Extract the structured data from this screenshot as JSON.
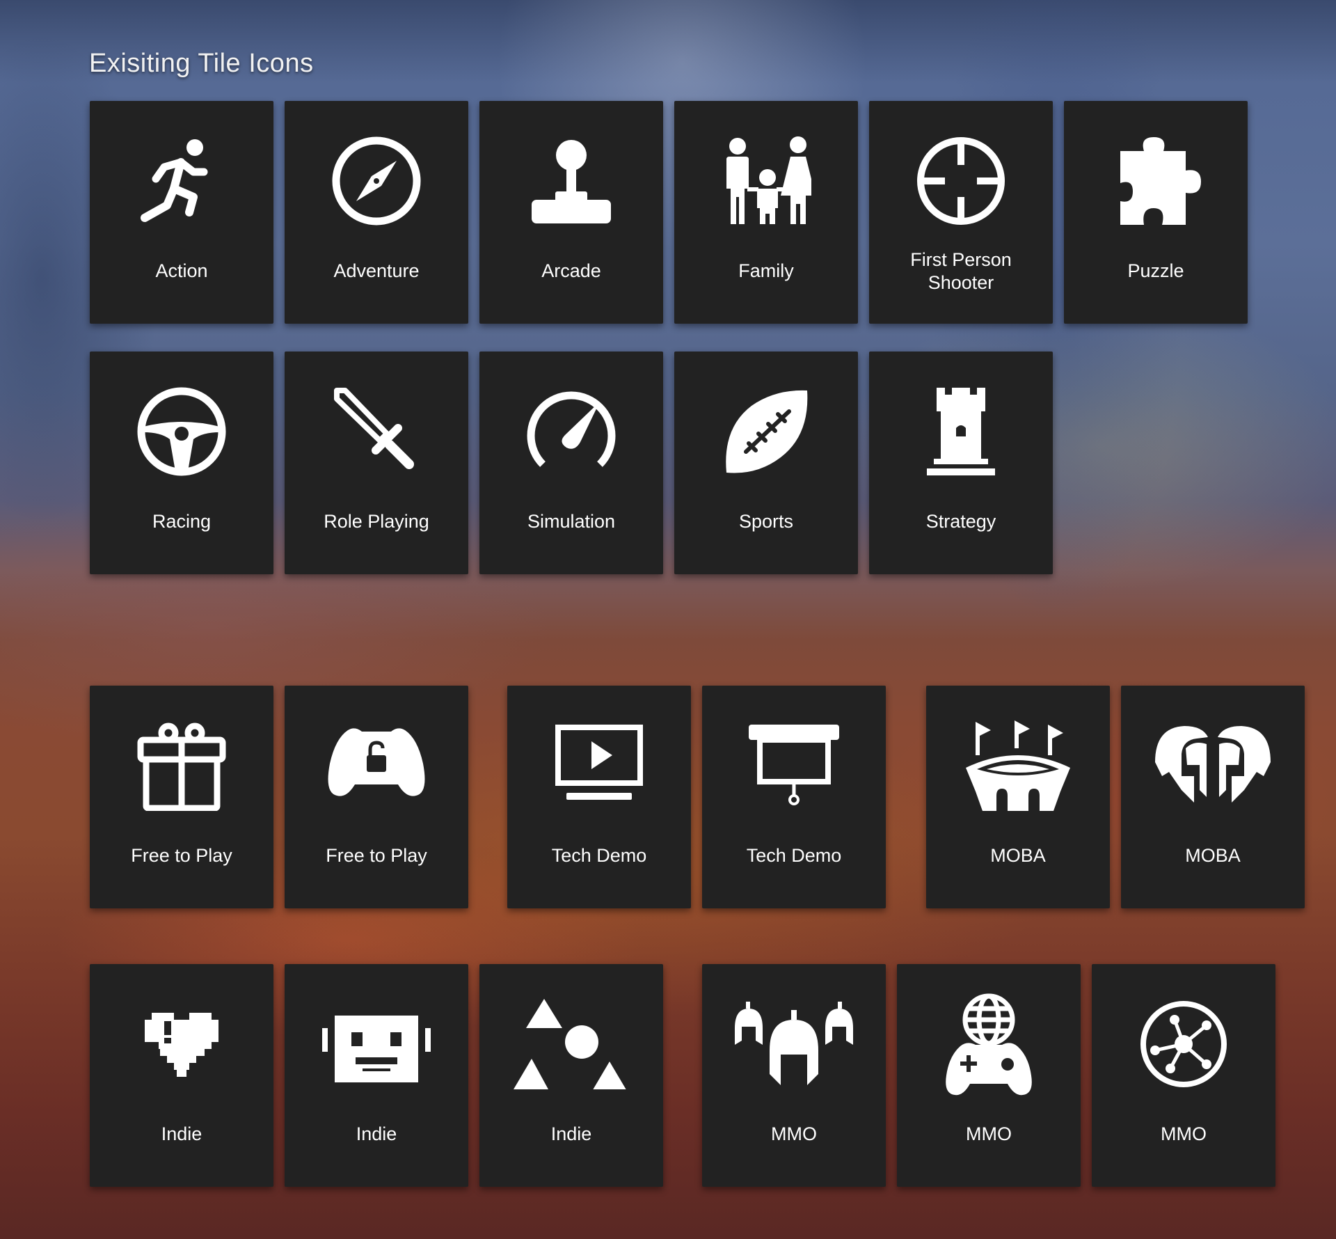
{
  "page": {
    "title": "Exisiting Tile Icons",
    "tile_color": "#222222",
    "icon_color": "#ffffff"
  },
  "rows": [
    {
      "tiles": [
        {
          "label": "Action",
          "icon": "running-person-icon"
        },
        {
          "label": "Adventure",
          "icon": "compass-icon"
        },
        {
          "label": "Arcade",
          "icon": "joystick-icon"
        },
        {
          "label": "Family",
          "icon": "family-icon"
        },
        {
          "label": "First Person Shooter",
          "icon": "crosshair-icon"
        },
        {
          "label": "Puzzle",
          "icon": "puzzle-piece-icon"
        }
      ]
    },
    {
      "tiles": [
        {
          "label": "Racing",
          "icon": "steering-wheel-icon"
        },
        {
          "label": "Role Playing",
          "icon": "sword-icon"
        },
        {
          "label": "Simulation",
          "icon": "speedometer-icon"
        },
        {
          "label": "Sports",
          "icon": "football-icon"
        },
        {
          "label": "Strategy",
          "icon": "chess-rook-icon"
        }
      ]
    },
    {
      "tiles": [
        {
          "label": "Free to Play",
          "icon": "gift-icon"
        },
        {
          "label": "Free to Play",
          "icon": "gamepad-lock-icon"
        },
        {
          "label": "Tech Demo",
          "icon": "video-monitor-icon"
        },
        {
          "label": "Tech Demo",
          "icon": "projector-screen-icon"
        },
        {
          "label": "MOBA",
          "icon": "stadium-icon"
        },
        {
          "label": "MOBA",
          "icon": "spartan-helmets-icon"
        }
      ]
    },
    {
      "tiles": [
        {
          "label": "Indie",
          "icon": "pixel-heart-icon"
        },
        {
          "label": "Indie",
          "icon": "pixel-robot-icon"
        },
        {
          "label": "Indie",
          "icon": "shapes-icon"
        },
        {
          "label": "MMO",
          "icon": "helmet-group-icon"
        },
        {
          "label": "MMO",
          "icon": "globe-gamepad-icon"
        },
        {
          "label": "MMO",
          "icon": "network-node-icon"
        }
      ]
    }
  ]
}
